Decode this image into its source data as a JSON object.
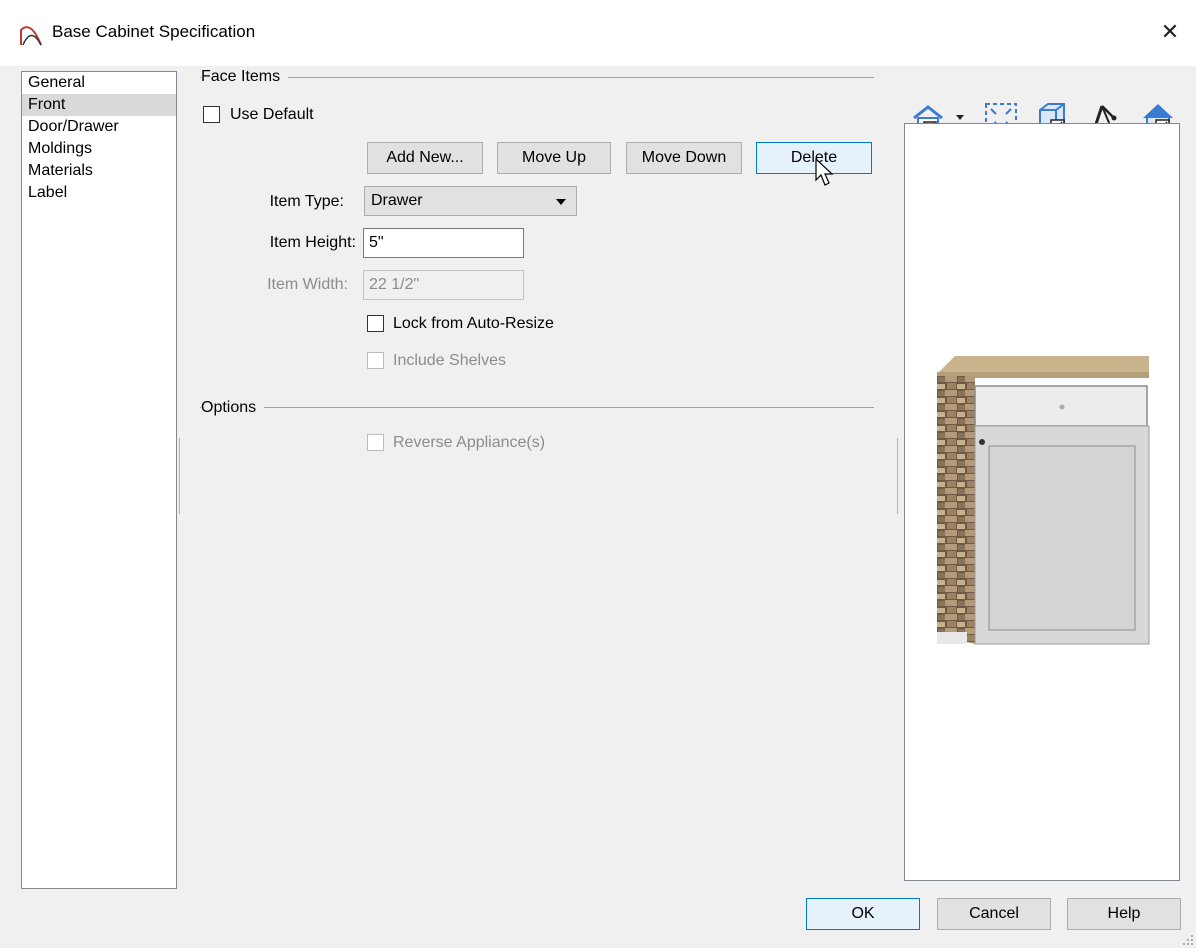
{
  "window": {
    "title": "Base Cabinet Specification",
    "close_glyph": "✕"
  },
  "nav": {
    "items": [
      {
        "label": "General",
        "selected": false
      },
      {
        "label": "Front",
        "selected": true
      },
      {
        "label": "Door/Drawer",
        "selected": false
      },
      {
        "label": "Moldings",
        "selected": false
      },
      {
        "label": "Materials",
        "selected": false
      },
      {
        "label": "Label",
        "selected": false
      }
    ]
  },
  "face_items": {
    "group_label": "Face Items",
    "use_default_label": "Use Default",
    "use_default_checked": false,
    "buttons": {
      "add_new": "Add New...",
      "move_up": "Move Up",
      "move_down": "Move Down",
      "delete": "Delete"
    },
    "item_type": {
      "label": "Item Type:",
      "value": "Drawer"
    },
    "item_height": {
      "label": "Item Height:",
      "value": "5\""
    },
    "item_width": {
      "label": "Item Width:",
      "value": "22 1/2\"",
      "disabled": true
    },
    "lock_auto_resize": {
      "label": "Lock from Auto-Resize",
      "checked": false
    },
    "include_shelves": {
      "label": "Include Shelves",
      "checked": false,
      "disabled": true
    }
  },
  "options": {
    "group_label": "Options",
    "reverse_appliance": {
      "label": "Reverse Appliance(s)",
      "checked": false,
      "disabled": true
    }
  },
  "preview_toolbar": {
    "icons": [
      "camera-view-dropdown-icon",
      "fill-window-icon",
      "show-cabinet-icon",
      "pivot-rotate-icon",
      "show-house-icon"
    ]
  },
  "footer": {
    "ok": "OK",
    "cancel": "Cancel",
    "help": "Help"
  },
  "colors": {
    "accent": "#0078d7",
    "dialog_bg": "#f0f0f0",
    "toolbar_blue": "#3a7bd5"
  }
}
